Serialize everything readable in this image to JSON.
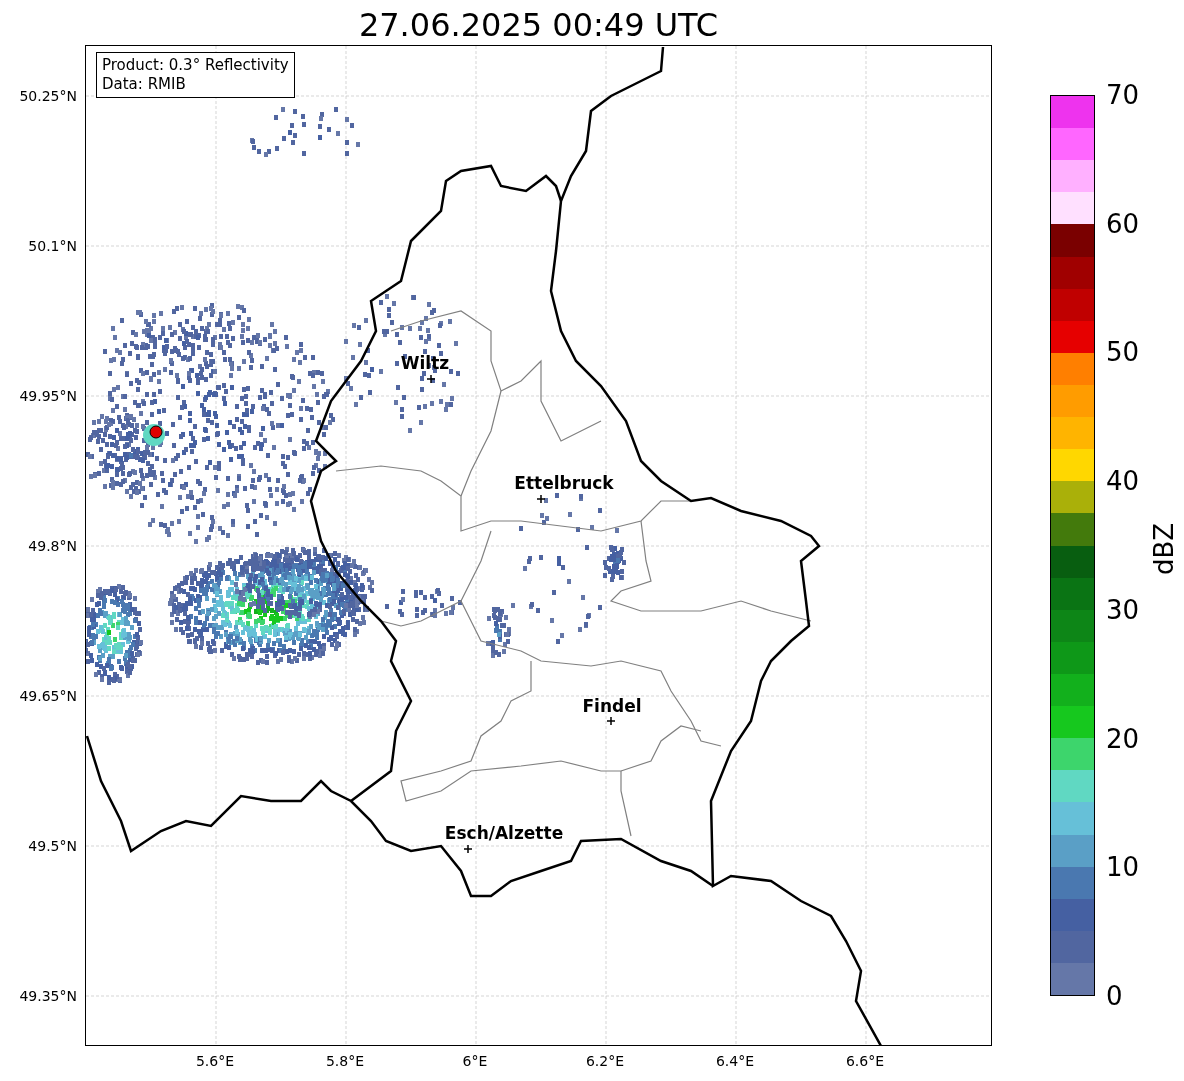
{
  "title": "27.06.2025 00:49 UTC",
  "info_box": [
    "Product: 0.3° Reflectivity",
    "Data: RMIB"
  ],
  "lat_ticks": [
    "50.25°N",
    "50.1°N",
    "49.95°N",
    "49.8°N",
    "49.65°N",
    "49.5°N",
    "49.35°N"
  ],
  "lon_ticks": [
    "5.6°E",
    "5.8°E",
    "6°E",
    "6.2°E",
    "6.4°E",
    "6.6°E"
  ],
  "cities": [
    {
      "name": "Wiltz"
    },
    {
      "name": "Ettelbruck"
    },
    {
      "name": "Findel"
    },
    {
      "name": "Esch/Alzette"
    }
  ],
  "colorbar": {
    "label": "dBZ",
    "ticks": [
      "70",
      "60",
      "50",
      "40",
      "30",
      "20",
      "10",
      "0"
    ],
    "segments": [
      {
        "color": "#ee33ee"
      },
      {
        "color": "#ff66ff"
      },
      {
        "color": "#ffb0ff"
      },
      {
        "color": "#ffe0ff"
      },
      {
        "color": "#7a0000"
      },
      {
        "color": "#a00000"
      },
      {
        "color": "#c00000"
      },
      {
        "color": "#e60000"
      },
      {
        "color": "#ff7f00"
      },
      {
        "color": "#ff9c00"
      },
      {
        "color": "#ffb400"
      },
      {
        "color": "#ffd700"
      },
      {
        "color": "#aab009"
      },
      {
        "color": "#437a0c"
      },
      {
        "color": "#085e10"
      },
      {
        "color": "#0a7414"
      },
      {
        "color": "#0d8617"
      },
      {
        "color": "#0e9818"
      },
      {
        "color": "#12b01c"
      },
      {
        "color": "#16c81e"
      },
      {
        "color": "#3dd56c"
      },
      {
        "color": "#60d8c2"
      },
      {
        "color": "#66c0d8"
      },
      {
        "color": "#5a9fc6"
      },
      {
        "color": "#4a78b0"
      },
      {
        "color": "#4560a2"
      },
      {
        "color": "#5166a0"
      },
      {
        "color": "#6577a8"
      }
    ]
  }
}
